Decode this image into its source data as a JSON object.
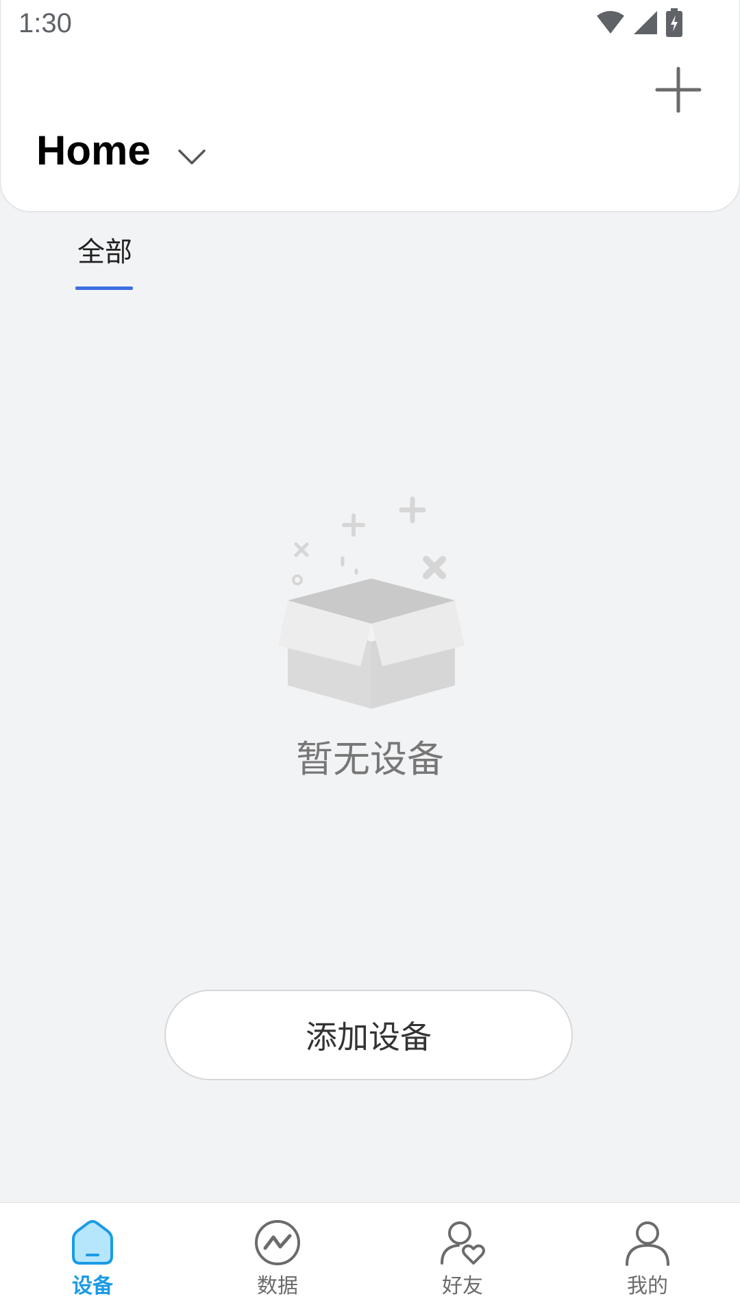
{
  "status_bar": {
    "time": "1:30",
    "icons": [
      "wifi-icon",
      "signal-icon",
      "battery-charging-icon"
    ]
  },
  "header": {
    "title": "Home",
    "dropdown_icon": "chevron-down-icon",
    "action_icon": "plus-icon"
  },
  "tabs": [
    {
      "label": "全部",
      "active": true
    }
  ],
  "empty_state": {
    "icon": "empty-box-icon",
    "text": "暂无设备"
  },
  "add_device": {
    "label": "添加设备"
  },
  "bottom_nav": {
    "items": [
      {
        "label": "设备",
        "icon": "home-device-icon",
        "active": true
      },
      {
        "label": "数据",
        "icon": "data-chart-icon",
        "active": false
      },
      {
        "label": "好友",
        "icon": "friend-heart-icon",
        "active": false
      },
      {
        "label": "我的",
        "icon": "profile-icon",
        "active": false
      }
    ]
  },
  "colors": {
    "accent": "#1a9be6",
    "tab_indicator": "#3b6fe0",
    "background": "#f2f3f5"
  }
}
